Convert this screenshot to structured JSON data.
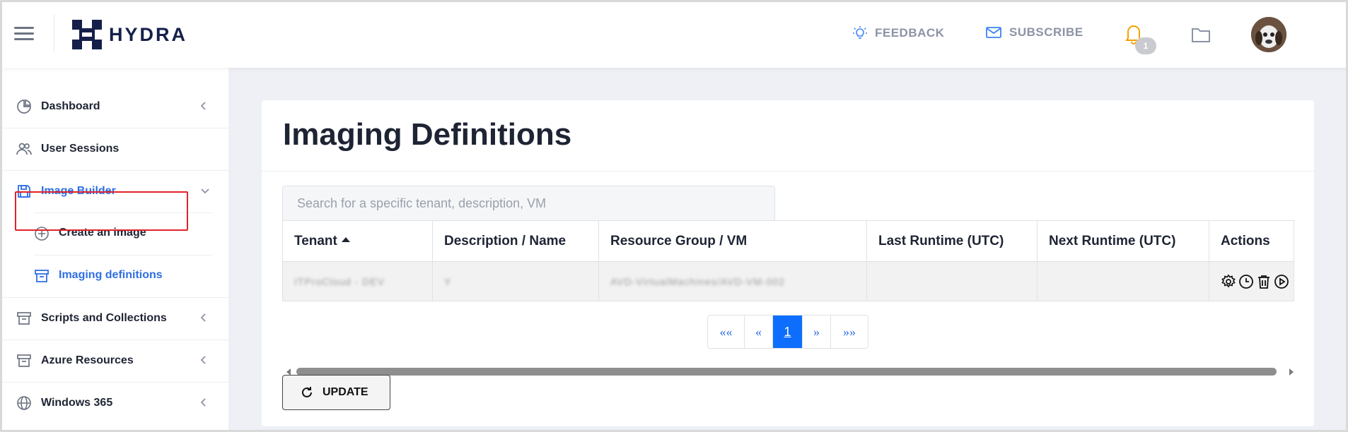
{
  "header": {
    "brand": "HYDRA",
    "feedback_label": "FEEDBACK",
    "subscribe_label": "SUBSCRIBE",
    "notification_count": "1"
  },
  "sidebar": {
    "items": [
      {
        "label": "Dashboard",
        "icon": "pie-chart-icon"
      },
      {
        "label": "User Sessions",
        "icon": "users-icon"
      },
      {
        "label": "Image Builder",
        "icon": "save-icon"
      },
      {
        "label": "Create an image",
        "icon": "plus-circle-icon"
      },
      {
        "label": "Imaging definitions",
        "icon": "archive-icon"
      },
      {
        "label": "Scripts and Collections",
        "icon": "archive-icon"
      },
      {
        "label": "Azure Resources",
        "icon": "archive-icon"
      },
      {
        "label": "Windows 365",
        "icon": "globe-icon"
      }
    ]
  },
  "main": {
    "title": "Imaging Definitions",
    "search_placeholder": "Search for a specific tenant, description, VM",
    "columns": [
      "Tenant",
      "Description / Name",
      "Resource Group / VM",
      "Last Runtime (UTC)",
      "Next Runtime (UTC)",
      "Actions"
    ],
    "rows": [
      {
        "tenant": "ITProCloud - DEV",
        "description": "Y",
        "resource_group": "AVD-VirtualMachines/AVD-VM-002",
        "last_runtime": "",
        "next_runtime": ""
      }
    ],
    "pagination": {
      "first": "««",
      "prev": "«",
      "current": "1",
      "next": "»",
      "last": "»»"
    },
    "update_label": "UPDATE"
  },
  "colors": {
    "accent": "#2f6fe4",
    "page_current": "#0d6efd",
    "highlight": "#e0232a",
    "brand": "#15204a"
  }
}
